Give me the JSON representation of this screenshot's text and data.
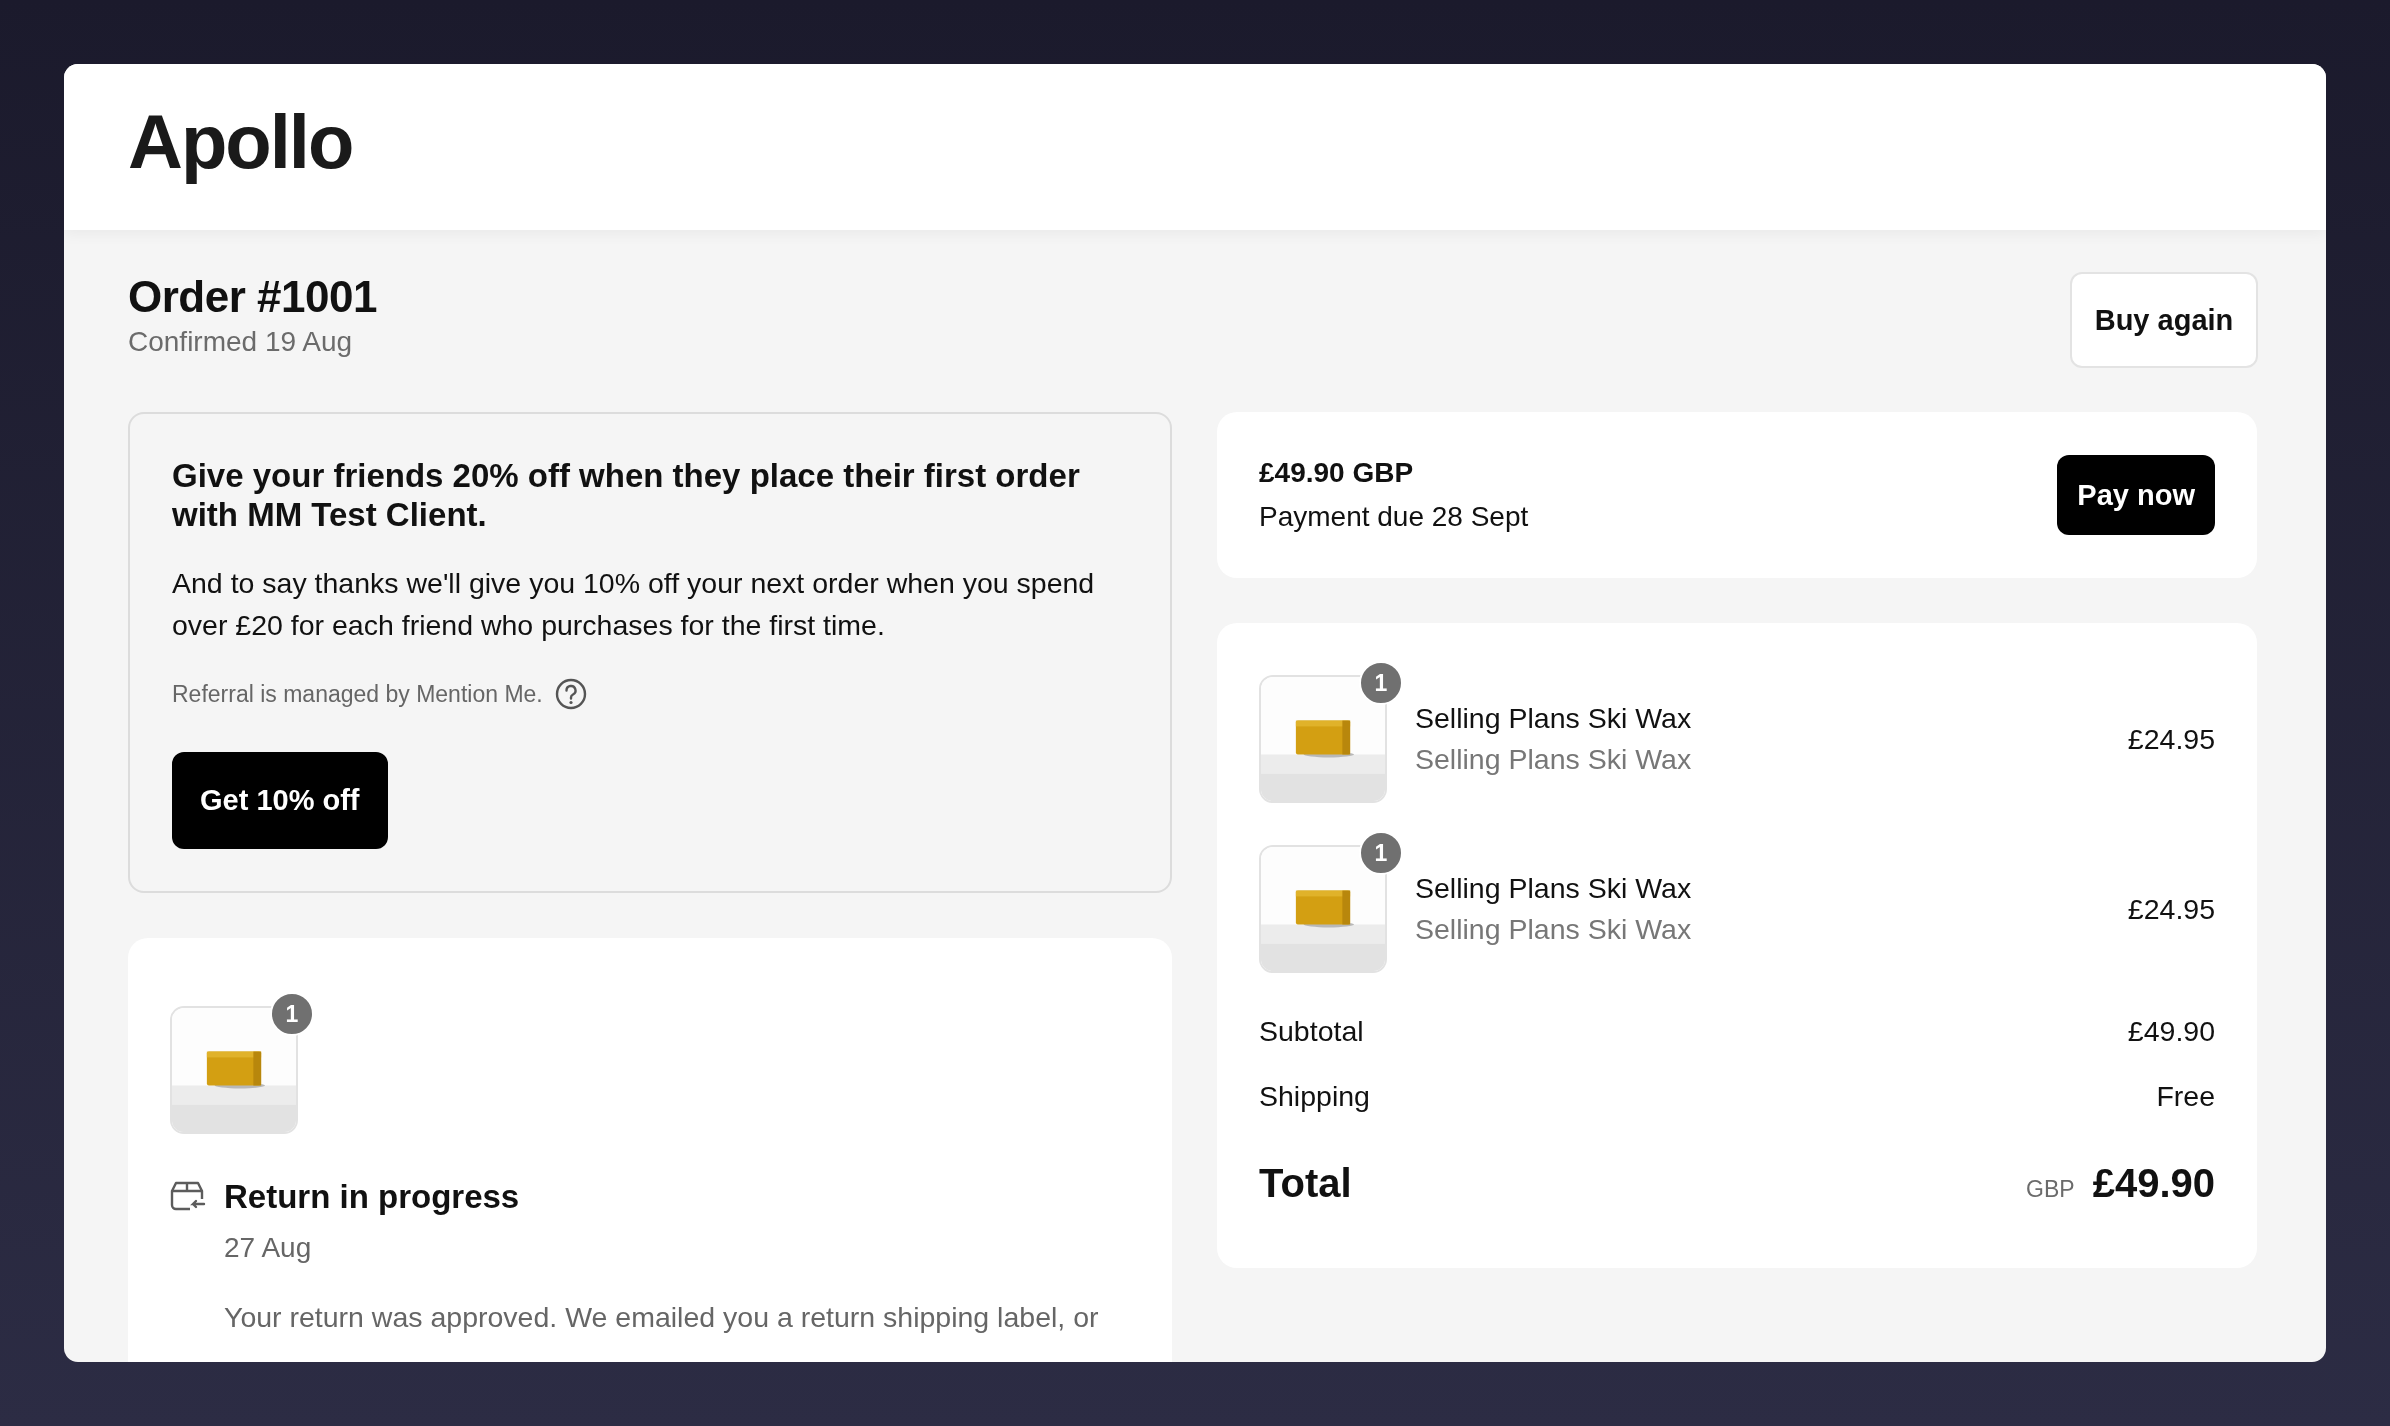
{
  "store": {
    "name": "Apollo"
  },
  "order": {
    "title": "Order #1001",
    "confirmed": "Confirmed 19 Aug",
    "buy_again": "Buy again"
  },
  "referral": {
    "heading": "Give your friends 20% off when they place their first order with MM Test Client.",
    "body": "And to say thanks we'll give you 10% off your next order when you spend over £20 for each friend who purchases for the first time.",
    "note": "Referral is managed by Mention Me.",
    "button": "Get 10% off"
  },
  "returns": [
    {
      "quantity": "1",
      "status": "Return in progress",
      "date": "27 Aug",
      "message": "Your return was approved. We emailed you a return shipping label, or"
    }
  ],
  "payment": {
    "amount": "£49.90 GBP",
    "due": "Payment due 28 Sept",
    "button": "Pay now"
  },
  "items": [
    {
      "quantity": "1",
      "name": "Selling Plans Ski Wax",
      "variant": "Selling Plans Ski Wax",
      "price": "£24.95"
    },
    {
      "quantity": "1",
      "name": "Selling Plans Ski Wax",
      "variant": "Selling Plans Ski Wax",
      "price": "£24.95"
    }
  ],
  "summary": [
    {
      "label": "Subtotal",
      "value": "£49.90"
    },
    {
      "label": "Shipping",
      "value": "Free"
    }
  ],
  "total": {
    "label": "Total",
    "currency": "GBP",
    "amount": "£49.90"
  }
}
